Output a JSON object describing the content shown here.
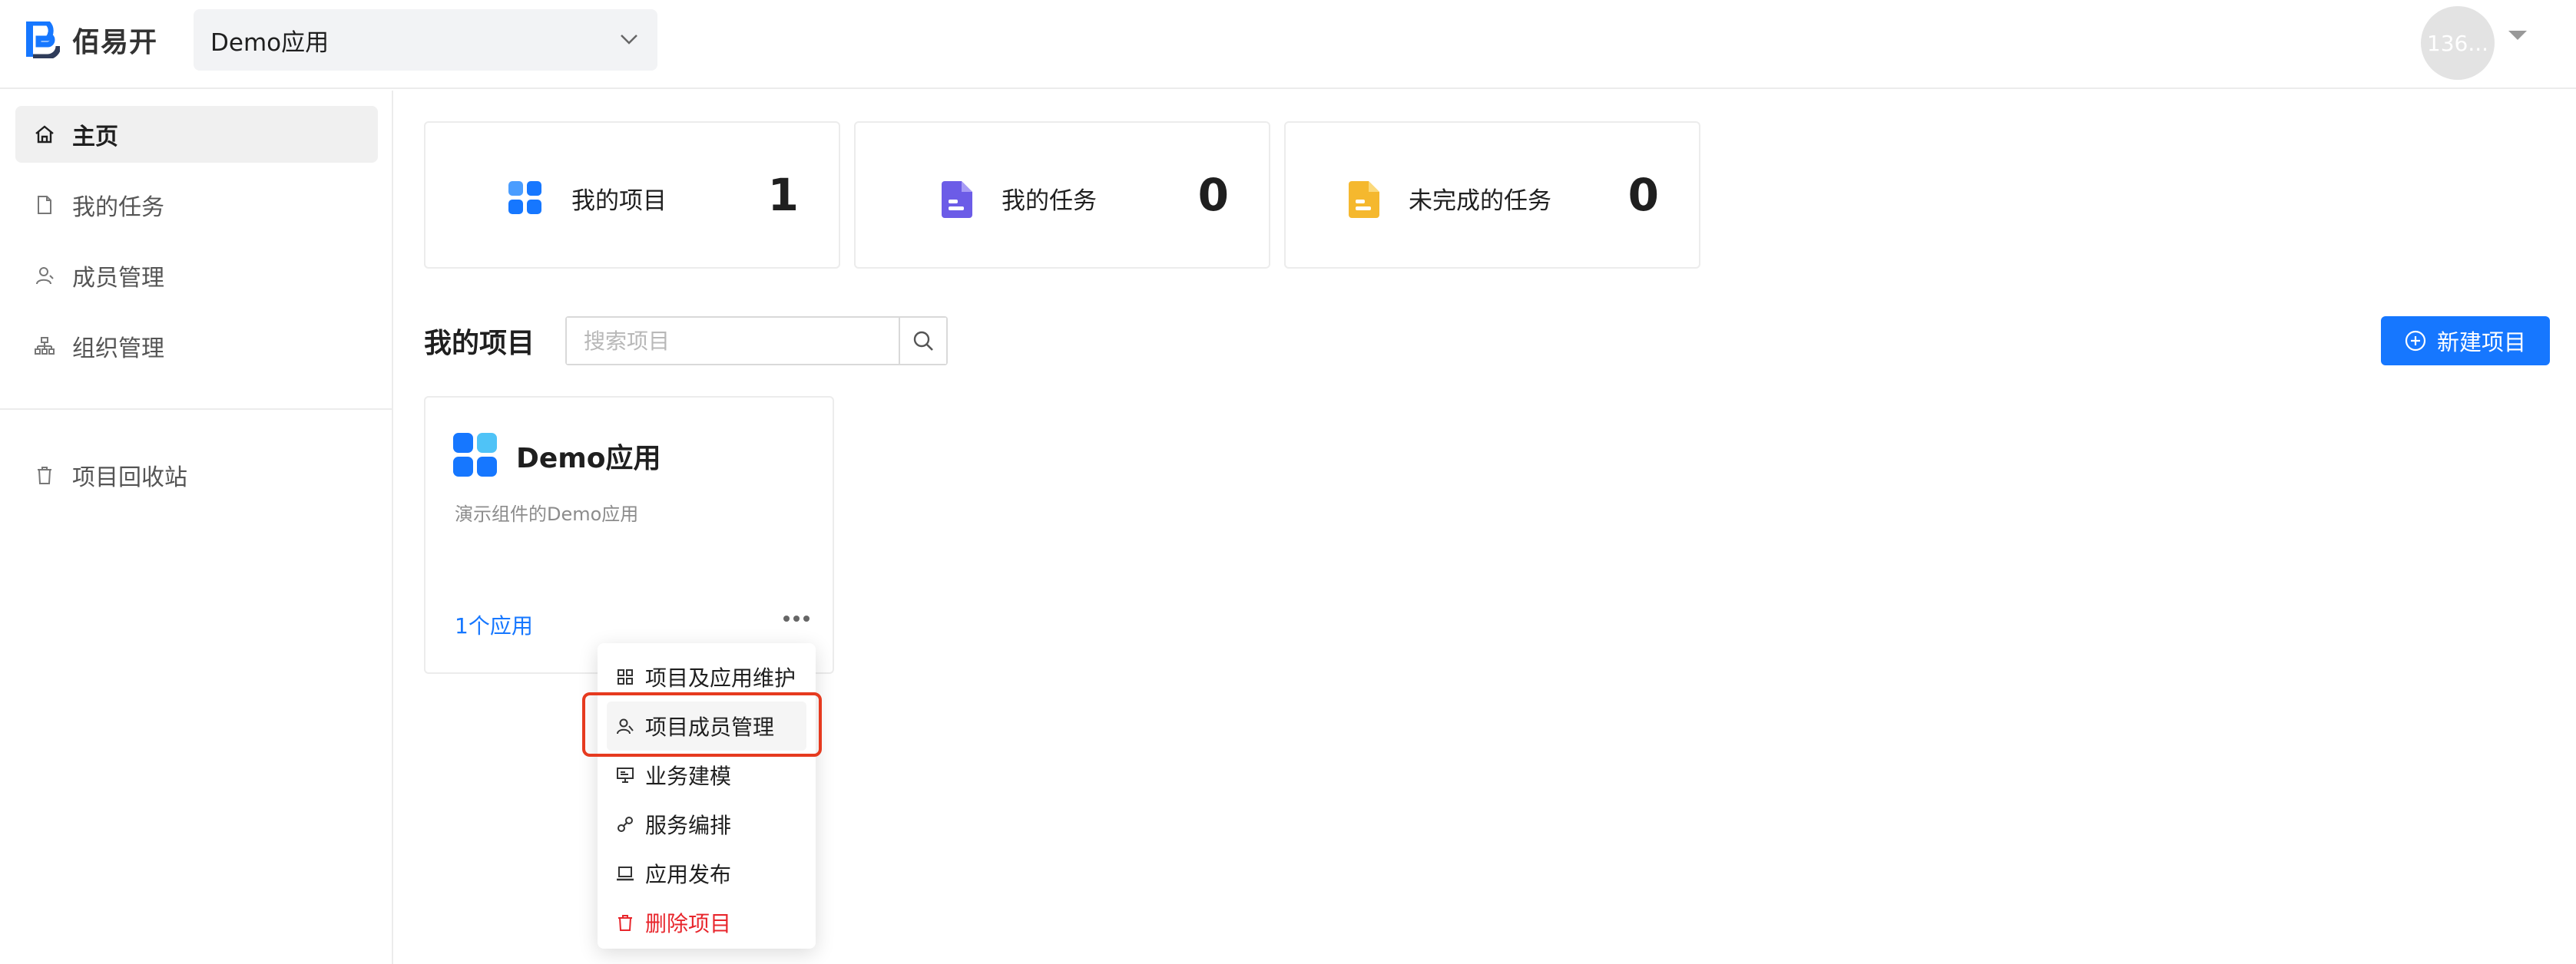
{
  "header": {
    "logo_text": "佰易开",
    "app_select": {
      "value": "Demo应用"
    },
    "avatar_text": "136..."
  },
  "sidebar": {
    "items": [
      {
        "label": "主页",
        "icon": "home-icon",
        "active": true
      },
      {
        "label": "我的任务",
        "icon": "file-icon"
      },
      {
        "label": "成员管理",
        "icon": "user-icon"
      },
      {
        "label": "组织管理",
        "icon": "org-icon"
      },
      {
        "label": "项目回收站",
        "icon": "trash-icon"
      }
    ]
  },
  "stats": [
    {
      "label": "我的项目",
      "value": "1",
      "icon": "apps-grid-icon",
      "color": "#3b82f6"
    },
    {
      "label": "我的任务",
      "value": "0",
      "icon": "document-icon",
      "color": "#6c5ce7"
    },
    {
      "label": "未完成的任务",
      "value": "0",
      "icon": "document-icon",
      "color": "#f5b82e"
    }
  ],
  "projects_section": {
    "title": "我的项目",
    "search_placeholder": "搜索项目",
    "new_button_label": "新建项目"
  },
  "project_card": {
    "name": "Demo应用",
    "description": "演示组件的Demo应用",
    "apps_count": "1个应用"
  },
  "context_menu": {
    "items": [
      {
        "label": "项目及应用维护",
        "icon": "grid-icon"
      },
      {
        "label": "项目成员管理",
        "icon": "members-icon"
      },
      {
        "label": "业务建模",
        "icon": "monitor-icon"
      },
      {
        "label": "服务编排",
        "icon": "link-icon"
      },
      {
        "label": "应用发布",
        "icon": "laptop-icon"
      },
      {
        "label": "删除项目",
        "icon": "delete-icon"
      }
    ]
  },
  "colors": {
    "accent": "#1677ff",
    "danger": "#e8262c",
    "highlight_border": "#e63a1f"
  }
}
